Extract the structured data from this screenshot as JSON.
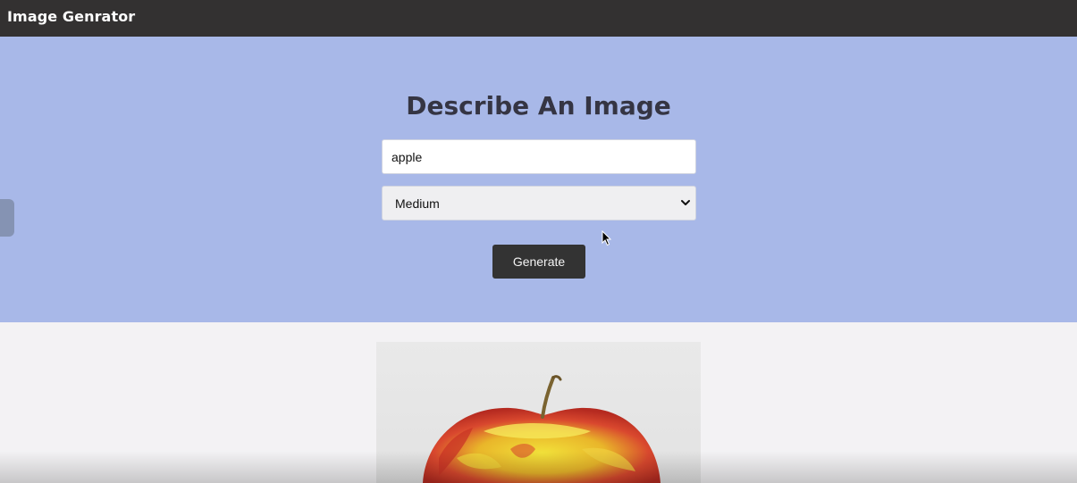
{
  "app": {
    "title": "Image Genrator"
  },
  "form": {
    "heading": "Describe An Image",
    "prompt_value": "apple",
    "size_selected": "Medium",
    "generate_label": "Generate"
  },
  "result": {
    "image_subject": "apple"
  },
  "colors": {
    "navbar": "#333131",
    "hero": "#a8b8e8",
    "button": "#333333",
    "page": "#f3f2f4"
  }
}
